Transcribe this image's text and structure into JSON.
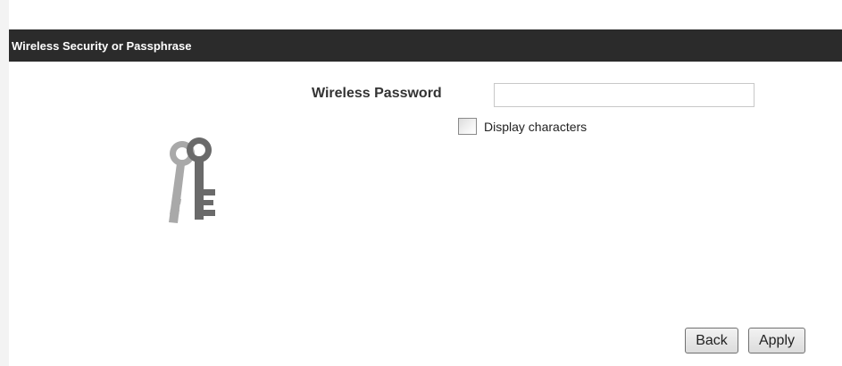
{
  "header": {
    "title": "Wireless Security or Passphrase"
  },
  "form": {
    "password_label": "Wireless Password",
    "password_value": "",
    "display_checkbox": {
      "label": "Display characters",
      "checked": false
    }
  },
  "actions": {
    "back_label": "Back",
    "apply_label": "Apply"
  },
  "icons": {
    "illustration": "keys-icon"
  },
  "colors": {
    "header_bg": "#2b2b2b",
    "header_text": "#ffffff"
  }
}
